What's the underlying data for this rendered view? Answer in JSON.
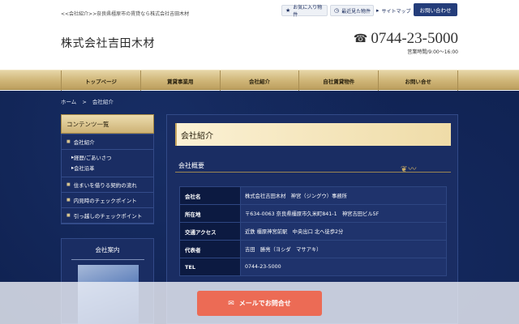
{
  "header": {
    "breadcrumb_text": "<<会社紹介>>奈良県橿原市の賃貸なら株式会社吉田木材",
    "favorites_label": "お気に入り物件",
    "recent_label": "最近見た物件",
    "sitemap_label": "サイトマップ",
    "contact_label": "お問い合わせ",
    "logo": "株式会社吉田木材",
    "phone": "0744-23-5000",
    "hours": "営業時間/9:00～16:00"
  },
  "nav": {
    "items": [
      "トップページ",
      "賃貸事業用",
      "会社紹介",
      "自社賃貸物件",
      "お問い合せ"
    ]
  },
  "breadcrumb": {
    "home": "ホーム",
    "sep": ">",
    "current": "会社紹介"
  },
  "sidebar": {
    "heading": "コンテンツ一覧",
    "items": [
      {
        "label": "会社紹介"
      },
      {
        "label": "住まいを借りる契約の流れ"
      },
      {
        "label": "内見時のチェックポイント"
      },
      {
        "label": "引っ越しのチェックポイント"
      }
    ],
    "subitems": [
      "経歴/ごあいさつ",
      "会社沿革"
    ],
    "card_title": "会社案内"
  },
  "content": {
    "title": "会社紹介",
    "subtitle": "会社概要",
    "rows": [
      {
        "label": "会社名",
        "value": "株式会社吉田木材　神宮（ジングウ）事務所"
      },
      {
        "label": "所在地",
        "value": "〒634-0063 奈良県橿原市久米町841-1　神宮吉田ビル5F"
      },
      {
        "label": "交通アクセス",
        "value": "近鉄 橿原神宮前駅　中央出口 北へ徒歩2分"
      },
      {
        "label": "代表者",
        "value": "吉田　勝亮（ヨシダ　マサアキ）"
      },
      {
        "label": "TEL",
        "value": "0744-23-5000"
      }
    ]
  },
  "footer_button": {
    "label": "メールでお問合せ"
  },
  "colors": {
    "navy": "#1a2d63",
    "gold": "#cfb577",
    "mail_button": "#ec6b55"
  }
}
